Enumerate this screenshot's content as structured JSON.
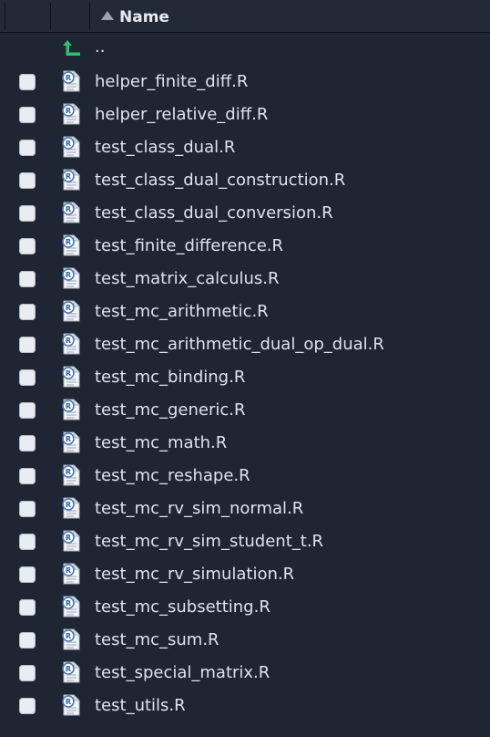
{
  "header": {
    "name_label": "Name"
  },
  "parent": {
    "label": ".."
  },
  "files": [
    {
      "name": "helper_finite_diff.R"
    },
    {
      "name": "helper_relative_diff.R"
    },
    {
      "name": "test_class_dual.R"
    },
    {
      "name": "test_class_dual_construction.R"
    },
    {
      "name": "test_class_dual_conversion.R"
    },
    {
      "name": "test_finite_difference.R"
    },
    {
      "name": "test_matrix_calculus.R"
    },
    {
      "name": "test_mc_arithmetic.R"
    },
    {
      "name": "test_mc_arithmetic_dual_op_dual.R"
    },
    {
      "name": "test_mc_binding.R"
    },
    {
      "name": "test_mc_generic.R"
    },
    {
      "name": "test_mc_math.R"
    },
    {
      "name": "test_mc_reshape.R"
    },
    {
      "name": "test_mc_rv_sim_normal.R"
    },
    {
      "name": "test_mc_rv_sim_student_t.R"
    },
    {
      "name": "test_mc_rv_simulation.R"
    },
    {
      "name": "test_mc_subsetting.R"
    },
    {
      "name": "test_mc_sum.R"
    },
    {
      "name": "test_special_matrix.R"
    },
    {
      "name": "test_utils.R"
    }
  ],
  "icons": {
    "parent": "parent-folder-icon",
    "file": "r-file-icon",
    "sort": "sort-ascending-icon"
  },
  "colors": {
    "background": "#1e2533",
    "header": "#232a37",
    "text": "#dde4ef",
    "parent_arrow": "#2fbf71"
  }
}
